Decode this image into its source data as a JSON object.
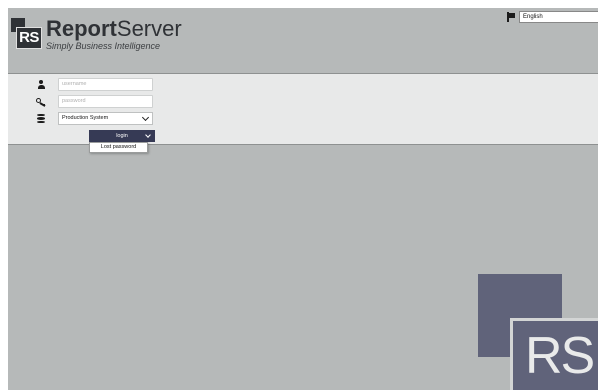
{
  "header": {
    "logo_mark": "RS",
    "title_bold": "Report",
    "title_rest": "Server",
    "tagline": "Simply Business Intelligence"
  },
  "language": {
    "flag_icon": "flag-icon",
    "selected": "English"
  },
  "login": {
    "username_placeholder": "username",
    "password_placeholder": "password",
    "system_selected": "Production System",
    "login_label": "login",
    "lost_password_label": "Lost password"
  },
  "background_mark": {
    "text": "RS"
  },
  "colors": {
    "page_bg": "#b6b9b9",
    "band_bg": "#e8e9e9",
    "button_bg": "#363a55",
    "mark_color": "#60637a"
  }
}
